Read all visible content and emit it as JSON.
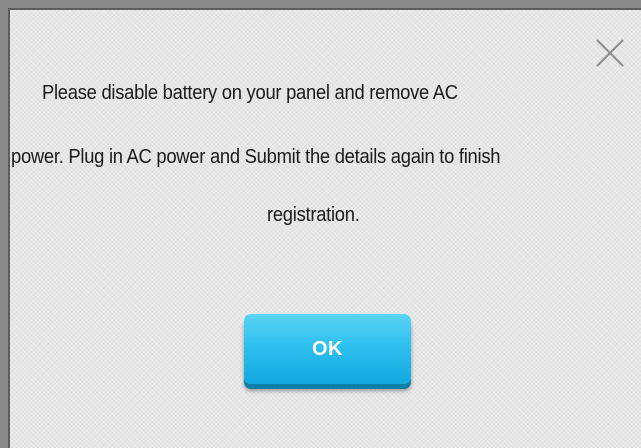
{
  "dialog": {
    "message_lines": [
      "Please disable battery on your panel and remove AC",
      "power. Plug in AC power and Submit the details again to finish",
      "registration."
    ],
    "ok_label": "OK",
    "close_icon": "close-icon"
  },
  "colors": {
    "dialog_background": "#e6e6e6",
    "button_top": "#5ad4f4",
    "button_bottom": "#12a8e0",
    "button_text": "#ffffff",
    "close_icon": "#8c8c8c",
    "text": "#1a1a1a"
  }
}
